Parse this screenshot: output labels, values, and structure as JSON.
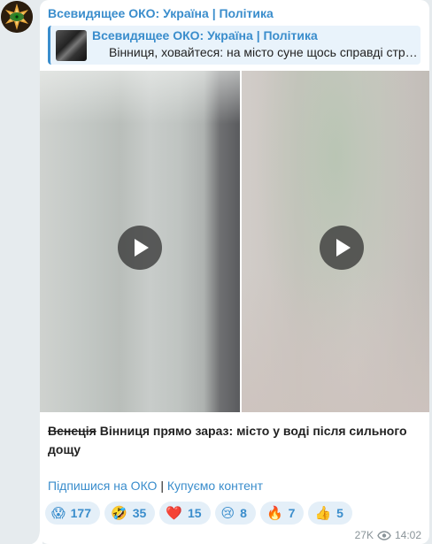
{
  "channel": {
    "name": "Всевидящее ОКО: Україна | Політика"
  },
  "reply": {
    "title": "Всевидящее ОКО: Україна | Політика",
    "text": "Вінниця, ховайтеся: на місто суне щось справді стр…"
  },
  "media": {
    "videos": [
      {
        "name": "video-left"
      },
      {
        "name": "video-right"
      }
    ]
  },
  "caption": {
    "struck": "Венеція",
    "text": " Вінниця прямо зараз: місто у воді після сильного дощу"
  },
  "links": {
    "subscribe": "Підпишися на ОКО",
    "separator": "|",
    "buy": "Купуємо контент"
  },
  "reactions": [
    {
      "emoji": "😱",
      "count": "177"
    },
    {
      "emoji": "🤣",
      "count": "35"
    },
    {
      "emoji": "❤️",
      "count": "15"
    },
    {
      "emoji": "😢",
      "count": "8"
    },
    {
      "emoji": "🔥",
      "count": "7"
    },
    {
      "emoji": "👍",
      "count": "5"
    }
  ],
  "meta": {
    "views": "27K",
    "time": "14:02"
  },
  "colors": {
    "accent": "#3a8dcc",
    "background": "#e6ebee",
    "reaction_bg": "#e4eff8"
  }
}
